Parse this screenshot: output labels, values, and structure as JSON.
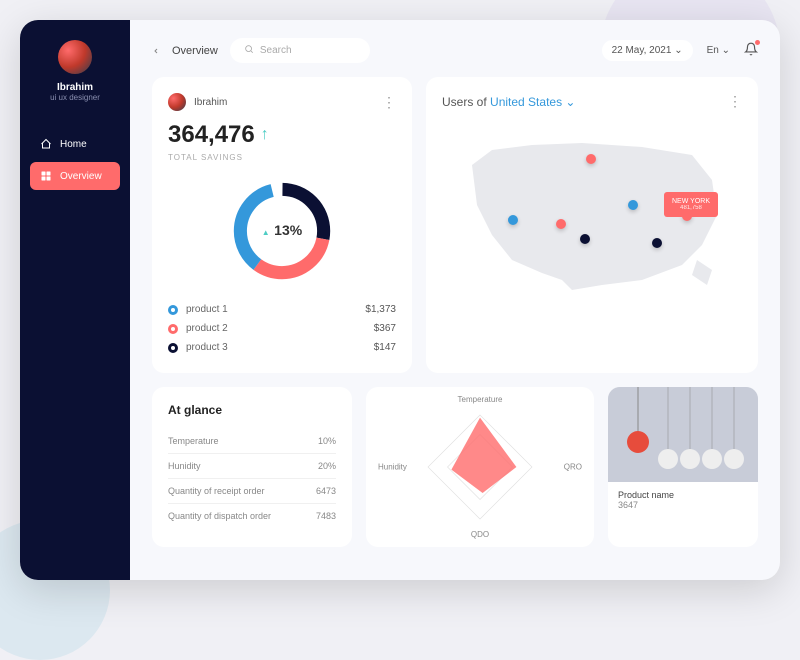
{
  "sidebar": {
    "username": "Ibrahim",
    "role": "ui ux designer",
    "items": [
      {
        "label": "Home"
      },
      {
        "label": "Overview"
      }
    ]
  },
  "topbar": {
    "page": "Overview",
    "search_placeholder": "Search",
    "date": "22 May, 2021",
    "lang": "En"
  },
  "savings": {
    "user": "Ibrahim",
    "value": "364,476",
    "label": "TOTAL SAVINGS",
    "pct": "13%",
    "products": [
      {
        "name": "product 1",
        "value": "$1,373",
        "color": "#3498db"
      },
      {
        "name": "product 2",
        "value": "$367",
        "color": "#ff6b6b"
      },
      {
        "name": "product 3",
        "value": "$147",
        "color": "#0b1033"
      }
    ]
  },
  "map": {
    "prefix": "Users of",
    "country": "United States",
    "tag_name": "NEW YORK",
    "tag_value": "481,758"
  },
  "glance": {
    "title": "At glance",
    "rows": [
      {
        "label": "Temperature",
        "value": "10%"
      },
      {
        "label": "Hunidity",
        "value": "20%"
      },
      {
        "label": "Quantity of receipt order",
        "value": "6473"
      },
      {
        "label": "Quantity of dispatch order",
        "value": "7483"
      }
    ]
  },
  "radar": {
    "labels": {
      "top": "Temperature",
      "left": "Hunidity",
      "right": "QRO",
      "bottom": "QDO"
    }
  },
  "product_card": {
    "name": "Product name",
    "value": "3647"
  },
  "chart_data": [
    {
      "type": "pie",
      "title": "Total Savings",
      "series": [
        {
          "name": "product 1",
          "value": 1373,
          "color": "#3498db"
        },
        {
          "name": "product 2",
          "value": 367,
          "color": "#ff6b6b"
        },
        {
          "name": "product 3",
          "value": 147,
          "color": "#0b1033"
        }
      ],
      "center_label": "13%"
    },
    {
      "type": "radar",
      "categories": [
        "Temperature",
        "Hunidity",
        "QDO",
        "QRO"
      ],
      "values": [
        0.9,
        0.5,
        0.4,
        0.55
      ]
    }
  ]
}
